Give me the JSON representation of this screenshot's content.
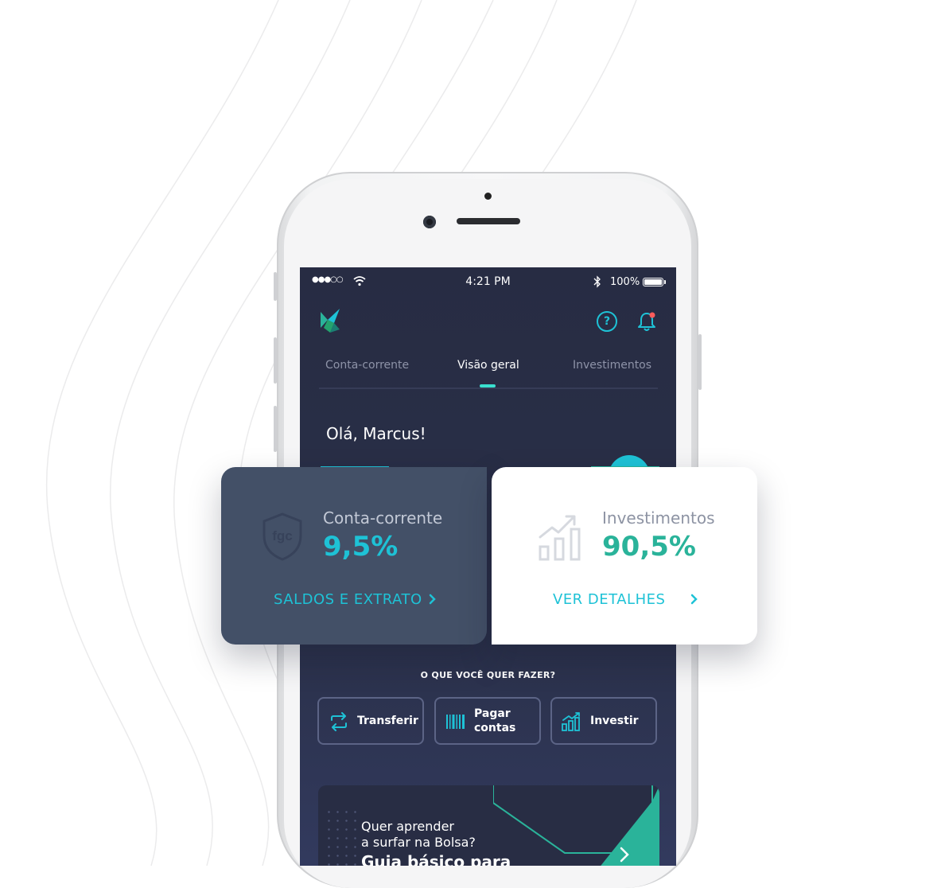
{
  "status_bar": {
    "signal": "●●●○○",
    "time": "4:21 PM",
    "battery": "100%"
  },
  "header": {
    "help_symbol": "?",
    "icons": [
      "logo-icon",
      "help-icon",
      "bell-icon"
    ],
    "notification": true
  },
  "tabs": [
    {
      "label": "Conta-corrente",
      "active": false
    },
    {
      "label": "Visão geral",
      "active": true
    },
    {
      "label": "Investimentos",
      "active": false
    }
  ],
  "greeting": "Olá, Marcus!",
  "cards": {
    "conta": {
      "label": "Conta-corrente",
      "value": "9,5%",
      "link": "SALDOS E EXTRATO",
      "icon": "fgc-shield-icon",
      "icon_text": "fgc"
    },
    "investimentos": {
      "label": "Investimentos",
      "value": "90,5%",
      "link": "VER DETALHES",
      "icon": "growth-chart-icon"
    }
  },
  "actions_title": "O QUE VOCÊ QUER FAZER?",
  "actions": [
    {
      "label": "Transferir",
      "icon": "transfer-icon"
    },
    {
      "label_line1": "Pagar",
      "label_line2": "contas",
      "icon": "barcode-icon"
    },
    {
      "label": "Investir",
      "icon": "bar-chart-icon"
    }
  ],
  "promo": {
    "line1": "Quer aprender",
    "line2": "a surfar na Bolsa?",
    "headline": "Guia básico para"
  },
  "colors": {
    "accent_cyan": "#1ec2d6",
    "accent_green": "#2ab39a",
    "screen_bg": "#272c43",
    "card_dark": "#435067"
  }
}
